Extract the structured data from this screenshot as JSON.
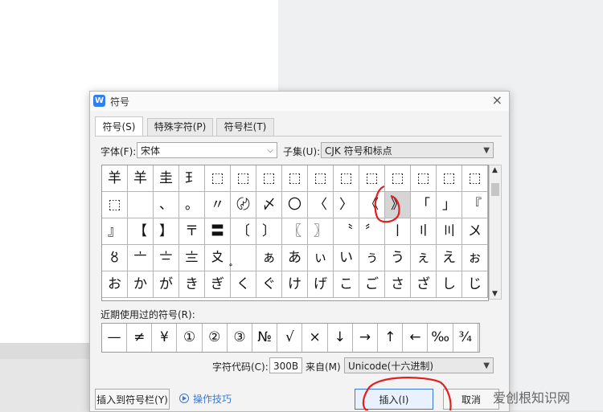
{
  "dialog": {
    "title": "符号",
    "app_icon": "W",
    "close": "×"
  },
  "tabs": [
    {
      "label": "符号(S)"
    },
    {
      "label": "特殊字符(P)"
    },
    {
      "label": "符号栏(T)"
    }
  ],
  "font": {
    "label": "字体(F):",
    "value": "宋体"
  },
  "subset": {
    "label": "子集(U):",
    "value": "CJK 符号和标点"
  },
  "grid": {
    "rows": [
      [
        "羊",
        "羊",
        "圭",
        "𤣩",
        "⬚",
        "⬚",
        "⬚",
        "⬚",
        "⬚",
        "⬚",
        "⬚",
        "⬚",
        "⬚",
        "⬚",
        "⬚"
      ],
      [
        "⬚",
        "",
        "、",
        "。",
        "〃",
        "〄",
        "〆",
        "〇",
        "〈",
        "〉",
        "《",
        "》",
        "「",
        "」",
        "『"
      ],
      [
        "』",
        "【",
        "】",
        "〒",
        "〓",
        "〔",
        "〕",
        "〖",
        "〗",
        "〝",
        "〞",
        "〡",
        "〢",
        "〣",
        "〤"
      ],
      [
        "〥",
        "〦",
        "〧",
        "〨",
        "〩",
        "〪",
        "ぁ",
        "あ",
        "ぃ",
        "い",
        "ぅ",
        "う",
        "ぇ",
        "え",
        "ぉ"
      ],
      [
        "お",
        "か",
        "が",
        "き",
        "ぎ",
        "く",
        "ぐ",
        "け",
        "げ",
        "こ",
        "ご",
        "さ",
        "ざ",
        "し",
        "じ"
      ]
    ],
    "selected": "》"
  },
  "recent": {
    "label": "近期使用过的符号(R):",
    "symbols": [
      "—",
      "≠",
      "¥",
      "①",
      "②",
      "③",
      "№",
      "√",
      "×",
      "↓",
      "→",
      "↑",
      "←",
      "‰",
      "¾"
    ]
  },
  "char_code": {
    "label": "字符代码(C):",
    "value": "300B"
  },
  "from": {
    "label": "来自(M)",
    "value": "Unicode(十六进制)"
  },
  "buttons": {
    "insert_to_bar": "插入到符号栏(Y)",
    "tips": "操作技巧",
    "insert": "插入(I)",
    "cancel": "取消"
  },
  "watermark": "爱创根知识网"
}
